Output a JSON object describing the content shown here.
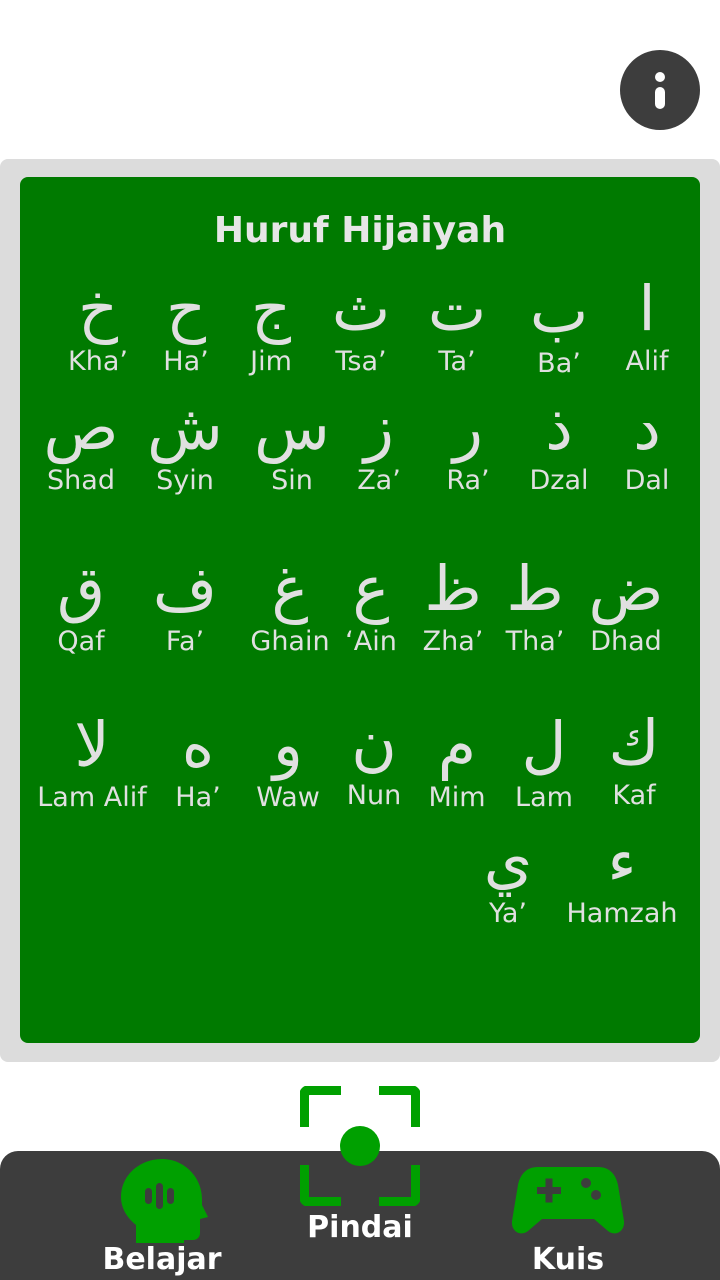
{
  "header": {
    "info_icon": "info-icon"
  },
  "board": {
    "title": "Huruf Hijaiyah",
    "letters": [
      {
        "glyph": "ا",
        "name": "Alif"
      },
      {
        "glyph": "ب",
        "name": "Ba’"
      },
      {
        "glyph": "ت",
        "name": "Ta’"
      },
      {
        "glyph": "ث",
        "name": "Tsa’"
      },
      {
        "glyph": "ج",
        "name": "Jim"
      },
      {
        "glyph": "ح",
        "name": "Ha’"
      },
      {
        "glyph": "خ",
        "name": "Kha’"
      },
      {
        "glyph": "د",
        "name": "Dal"
      },
      {
        "glyph": "ذ",
        "name": "Dzal"
      },
      {
        "glyph": "ر",
        "name": "Ra’"
      },
      {
        "glyph": "ز",
        "name": "Za’"
      },
      {
        "glyph": "س",
        "name": "Sin"
      },
      {
        "glyph": "ش",
        "name": "Syin"
      },
      {
        "glyph": "ص",
        "name": "Shad"
      },
      {
        "glyph": "ض",
        "name": "Dhad"
      },
      {
        "glyph": "ط",
        "name": "Tha’"
      },
      {
        "glyph": "ظ",
        "name": "Zha’"
      },
      {
        "glyph": "ع",
        "name": "‘Ain"
      },
      {
        "glyph": "غ",
        "name": "Ghain"
      },
      {
        "glyph": "ف",
        "name": "Fa’"
      },
      {
        "glyph": "ق",
        "name": "Qaf"
      },
      {
        "glyph": "ك",
        "name": "Kaf"
      },
      {
        "glyph": "ل",
        "name": "Lam"
      },
      {
        "glyph": "م",
        "name": "Mim"
      },
      {
        "glyph": "ن",
        "name": "Nun"
      },
      {
        "glyph": "و",
        "name": "Waw"
      },
      {
        "glyph": "ه",
        "name": "Ha’"
      },
      {
        "glyph": "لا",
        "name": "Lam Alif"
      },
      {
        "glyph": "ء",
        "name": "Hamzah"
      },
      {
        "glyph": "ي",
        "name": "Ya’"
      }
    ]
  },
  "scan": {
    "label": "Pindai",
    "icon": "scan-frame-icon"
  },
  "nav": {
    "learn_label": "Belajar",
    "learn_icon": "head-speaking-icon",
    "quiz_label": "Kuis",
    "quiz_icon": "gamepad-icon"
  },
  "colors": {
    "board_green": "#007a00",
    "accent_green": "#00a000",
    "bar_dark": "#3d3d3d",
    "frame_gray": "#dcdcdc"
  }
}
